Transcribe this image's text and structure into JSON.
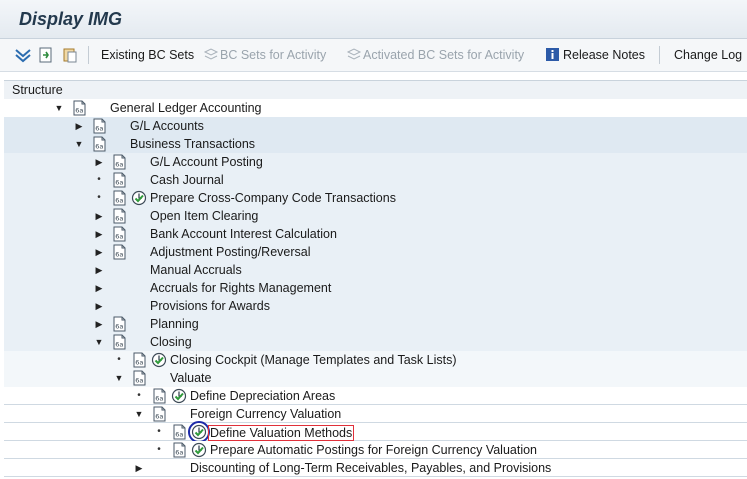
{
  "window": {
    "title": "Display IMG"
  },
  "toolbar": {
    "existing_bc_sets": "Existing BC Sets",
    "bc_sets_for_activity": "BC Sets for Activity",
    "activated_bc_sets_for_activity": "Activated BC Sets for Activity",
    "release_notes": "Release Notes",
    "change_log": "Change Log"
  },
  "structure": {
    "header": "Structure",
    "rows": [
      {
        "label": "General Ledger Accounting",
        "level": 0,
        "toggle": "expanded",
        "doc": true,
        "clock": false
      },
      {
        "label": "G/L Accounts",
        "level": 1,
        "toggle": "collapsed",
        "doc": true,
        "clock": false
      },
      {
        "label": "Business Transactions",
        "level": 1,
        "toggle": "expanded",
        "doc": true,
        "clock": false
      },
      {
        "label": "G/L Account Posting",
        "level": 2,
        "toggle": "collapsed",
        "doc": true,
        "clock": false
      },
      {
        "label": "Cash Journal",
        "level": 2,
        "toggle": "leaf",
        "doc": true,
        "clock": false
      },
      {
        "label": "Prepare Cross-Company Code Transactions",
        "level": 2,
        "toggle": "leaf",
        "doc": true,
        "clock": true
      },
      {
        "label": "Open Item Clearing",
        "level": 2,
        "toggle": "collapsed",
        "doc": true,
        "clock": false
      },
      {
        "label": "Bank Account Interest Calculation",
        "level": 2,
        "toggle": "collapsed",
        "doc": true,
        "clock": false
      },
      {
        "label": "Adjustment Posting/Reversal",
        "level": 2,
        "toggle": "collapsed",
        "doc": true,
        "clock": false
      },
      {
        "label": "Manual Accruals",
        "level": 2,
        "toggle": "collapsed",
        "doc": false,
        "clock": false
      },
      {
        "label": "Accruals for Rights Management",
        "level": 2,
        "toggle": "collapsed",
        "doc": false,
        "clock": false
      },
      {
        "label": "Provisions for Awards",
        "level": 2,
        "toggle": "collapsed",
        "doc": false,
        "clock": false
      },
      {
        "label": "Planning",
        "level": 2,
        "toggle": "collapsed",
        "doc": true,
        "clock": false
      },
      {
        "label": "Closing",
        "level": 2,
        "toggle": "expanded",
        "doc": true,
        "clock": false
      },
      {
        "label": "Closing Cockpit (Manage Templates and Task Lists)",
        "level": 3,
        "toggle": "leaf",
        "doc": true,
        "clock": true
      },
      {
        "label": "Valuate",
        "level": 3,
        "toggle": "expanded",
        "doc": true,
        "clock": false
      },
      {
        "label": "Define Depreciation Areas",
        "level": 4,
        "toggle": "leaf",
        "doc": true,
        "clock": true
      },
      {
        "label": "Foreign Currency Valuation",
        "level": 4,
        "toggle": "expanded",
        "doc": true,
        "clock": false
      },
      {
        "label": "Define Valuation Methods",
        "level": 5,
        "toggle": "leaf",
        "doc": true,
        "clock": true,
        "selected": true
      },
      {
        "label": "Prepare Automatic Postings for Foreign Currency Valuation",
        "level": 5,
        "toggle": "leaf",
        "doc": true,
        "clock": true
      },
      {
        "label": "Discounting of Long-Term Receivables, Payables, and Provisions",
        "level": 4,
        "toggle": "collapsed",
        "doc": false,
        "clock": false
      }
    ]
  },
  "colors": {
    "highlight_ring": "#1d2aa8",
    "selection_border": "#e0303a",
    "clock_green": "#2f9a3a"
  }
}
